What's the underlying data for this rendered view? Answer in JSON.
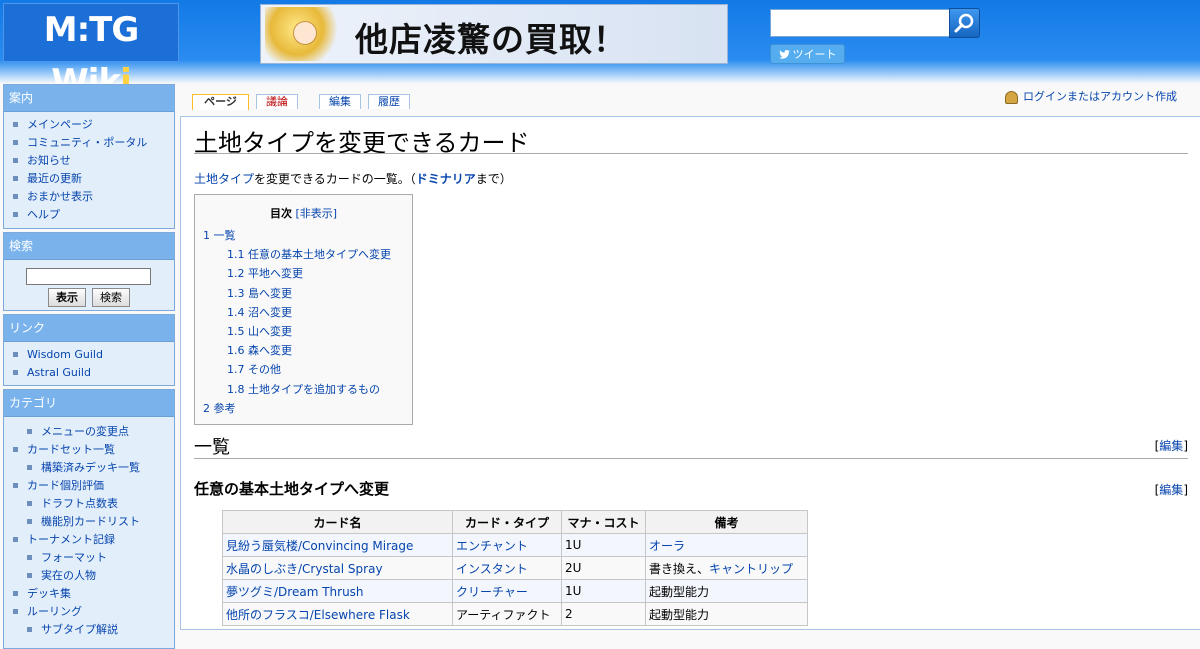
{
  "header": {
    "logo_main": "M:TG Wik",
    "logo_last": "i",
    "banner_text": "他店凌驚の買取！",
    "search_placeholder": "",
    "tweet_label": "ツイート"
  },
  "sidebar": {
    "nav_title": "案内",
    "nav_items": [
      "メインページ",
      "コミュニティ・ポータル",
      "お知らせ",
      "最近の更新",
      "おまかせ表示",
      "ヘルプ"
    ],
    "search_title": "検索",
    "search_go": "表示",
    "search_search": "検索",
    "links_title": "リンク",
    "links_items": [
      "Wisdom Guild",
      "Astral Guild"
    ],
    "category_title": "カテゴリ",
    "category_items": [
      {
        "label": "メニューの変更点",
        "sub": true
      },
      {
        "label": "カードセット一覧",
        "sub": false
      },
      {
        "label": "構築済みデッキ一覧",
        "sub": true
      },
      {
        "label": "カード個別評価",
        "sub": false
      },
      {
        "label": "ドラフト点数表",
        "sub": true
      },
      {
        "label": "機能別カードリスト",
        "sub": true
      },
      {
        "label": "トーナメント記録",
        "sub": false
      },
      {
        "label": "フォーマット",
        "sub": true
      },
      {
        "label": "実在の人物",
        "sub": true
      },
      {
        "label": "デッキ集",
        "sub": false
      },
      {
        "label": "ルーリング",
        "sub": false
      },
      {
        "label": "サブタイプ解説",
        "sub": true
      }
    ]
  },
  "tabs": {
    "page": "ページ",
    "talk": "議論",
    "edit": "編集",
    "history": "履歴"
  },
  "login_text": "ログインまたはアカウント作成",
  "content": {
    "title": "土地タイプを変更できるカード",
    "intro_link": "土地タイプ",
    "intro_text": "を変更できるカードの一覧。（",
    "intro_bold": "ドミナリア",
    "intro_tail": "まで）",
    "toc_title": "目次",
    "toc_toggle": "[非表示]",
    "toc_items": [
      {
        "num": "1",
        "label": "一覧",
        "level": 1
      },
      {
        "num": "1.1",
        "label": "任意の基本土地タイプへ変更",
        "level": 2
      },
      {
        "num": "1.2",
        "label": "平地へ変更",
        "level": 2
      },
      {
        "num": "1.3",
        "label": "島へ変更",
        "level": 2
      },
      {
        "num": "1.4",
        "label": "沼へ変更",
        "level": 2
      },
      {
        "num": "1.5",
        "label": "山へ変更",
        "level": 2
      },
      {
        "num": "1.6",
        "label": "森へ変更",
        "level": 2
      },
      {
        "num": "1.7",
        "label": "その他",
        "level": 2
      },
      {
        "num": "1.8",
        "label": "土地タイプを追加するもの",
        "level": 2
      },
      {
        "num": "2",
        "label": "参考",
        "level": 1
      }
    ],
    "h2_list": "一覧",
    "h3_any": "任意の基本土地タイプへ変更",
    "edit_open": "[",
    "edit_label": "編集",
    "edit_close": "]"
  },
  "table": {
    "headers": [
      "カード名",
      "カード・タイプ",
      "マナ・コスト",
      "備考"
    ],
    "rows": [
      {
        "name": "見紛う蜃気楼/Convincing Mirage",
        "type": "エンチャント",
        "type_link": true,
        "cost": "1U",
        "note": "オーラ",
        "note_link": "",
        "note_plain": ""
      },
      {
        "name": "水晶のしぶき/Crystal Spray",
        "type": "インスタント",
        "type_link": true,
        "cost": "2U",
        "note": "",
        "note_plain": "書き換え、",
        "note_link": "キャントリップ"
      },
      {
        "name": "夢ツグミ/Dream Thrush",
        "type": "クリーチャー",
        "type_link": true,
        "cost": "1U",
        "note": "",
        "note_plain": "起動型能力",
        "note_link": ""
      },
      {
        "name": "他所のフラスコ/Elsewhere Flask",
        "type": "アーティファクト",
        "type_link": false,
        "cost": "2",
        "note": "",
        "note_plain": "起動型能力",
        "note_link": ""
      }
    ]
  }
}
